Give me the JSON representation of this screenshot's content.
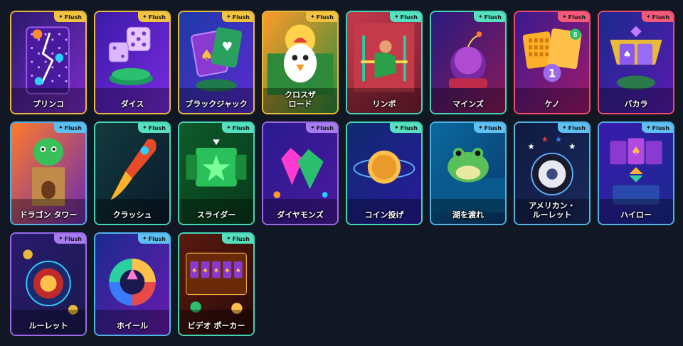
{
  "badge_label": "Flush",
  "games": [
    {
      "title": "プリンコ",
      "border": "#e8b93b",
      "badge": "#f2c341",
      "bg": [
        "#2a1a6e",
        "#7c2cc9"
      ],
      "art": "plinko"
    },
    {
      "title": "ダイス",
      "border": "#e8b93b",
      "badge": "#f2c341",
      "bg": [
        "#3b1aa8",
        "#7a2be0"
      ],
      "art": "dice"
    },
    {
      "title": "ブラックジャック",
      "border": "#e8b93b",
      "badge": "#f2c341",
      "bg": [
        "#1e3aa8",
        "#5a2bd0"
      ],
      "art": "blackjack"
    },
    {
      "title": "クロスザ\nロード",
      "border": "#e8b93b",
      "badge": "#f2c341",
      "bg": [
        "#ff9a2a",
        "#2e8a3a"
      ],
      "art": "chicken"
    },
    {
      "title": "リンボ",
      "border": "#42d6b5",
      "badge": "#56e0c0",
      "bg": [
        "#c43a4a",
        "#7a1e36"
      ],
      "art": "limbo"
    },
    {
      "title": "マインズ",
      "border": "#42d6b5",
      "badge": "#56e0c0",
      "bg": [
        "#2a1a7e",
        "#8a1a5a"
      ],
      "art": "mines"
    },
    {
      "title": "ケノ",
      "border": "#ef4a6a",
      "badge": "#f55a78",
      "bg": [
        "#3a1a8e",
        "#a01a6a"
      ],
      "art": "keno"
    },
    {
      "title": "バカラ",
      "border": "#ef4a6a",
      "badge": "#f55a78",
      "bg": [
        "#1a2a8e",
        "#5a1ab0"
      ],
      "art": "baccarat"
    },
    {
      "title": "ドラゴン タワー",
      "border": "#4fb2e8",
      "badge": "#5ec0f0",
      "bg": [
        "#ff7a2a",
        "#6a2ab0"
      ],
      "art": "dragon"
    },
    {
      "title": "クラッシュ",
      "border": "#42d6b5",
      "badge": "#56e0c0",
      "bg": [
        "#123a3e",
        "#0a1a2a"
      ],
      "art": "rocket"
    },
    {
      "title": "スライダー",
      "border": "#42d6b5",
      "badge": "#56e0c0",
      "bg": [
        "#0e5a2a",
        "#083a1a"
      ],
      "art": "slider"
    },
    {
      "title": "ダイヤモンズ",
      "border": "#9a6ae8",
      "badge": "#a87cf0",
      "bg": [
        "#2a1a8e",
        "#4a1a9e"
      ],
      "art": "diamonds"
    },
    {
      "title": "コイン投げ",
      "border": "#42d6b5",
      "badge": "#56e0c0",
      "bg": [
        "#0e2a6e",
        "#2a1a9e"
      ],
      "art": "coin"
    },
    {
      "title": "湖を渡れ",
      "border": "#4fb2e8",
      "badge": "#5ec0f0",
      "bg": [
        "#0a6a9e",
        "#0a3a6e"
      ],
      "art": "frog"
    },
    {
      "title": "アメリカン・\nルーレット",
      "border": "#4fb2e8",
      "badge": "#5ec0f0",
      "bg": [
        "#0e1a3e",
        "#1a2a5e"
      ],
      "art": "american"
    },
    {
      "title": "ハイロー",
      "border": "#4fb2e8",
      "badge": "#5ec0f0",
      "bg": [
        "#3a1aae",
        "#1a2a8e"
      ],
      "art": "hilo"
    },
    {
      "title": "ルーレット",
      "border": "#9a6ae8",
      "badge": "#a87cf0",
      "bg": [
        "#2a1a6e",
        "#1a1a4e"
      ],
      "art": "roulette"
    },
    {
      "title": "ホイール",
      "border": "#4fb2e8",
      "badge": "#5ec0f0",
      "bg": [
        "#1a2a8e",
        "#6a1ab0"
      ],
      "art": "wheel"
    },
    {
      "title": "ビデオ ポーカー",
      "border": "#42d6b5",
      "badge": "#56e0c0",
      "bg": [
        "#5a1a0e",
        "#2a0a0a"
      ],
      "art": "videopoker"
    }
  ]
}
